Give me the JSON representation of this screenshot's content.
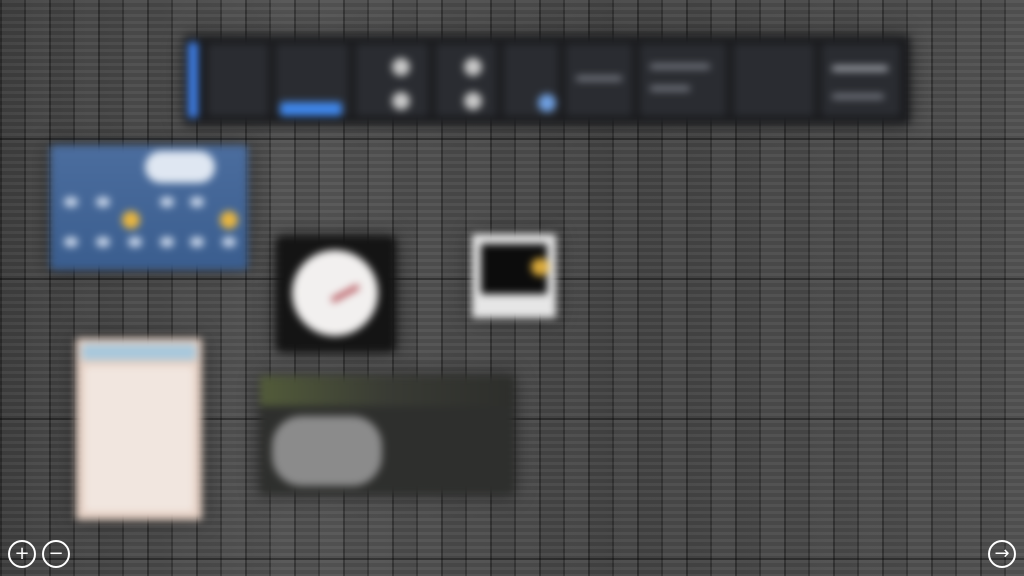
{
  "desktop": {
    "background": "dark-wood",
    "gadgets": [
      {
        "id": "toolbar",
        "name": "system-toolbar-gadget"
      },
      {
        "id": "weather",
        "name": "weather-gadget"
      },
      {
        "id": "clock",
        "name": "clock-gadget"
      },
      {
        "id": "photo",
        "name": "photo-gadget"
      },
      {
        "id": "calendar",
        "name": "calendar-gadget"
      },
      {
        "id": "media",
        "name": "media-gadget"
      }
    ]
  },
  "controls": {
    "zoom_in_icon": "plus-circle-icon",
    "zoom_out_icon": "minus-circle-icon",
    "next_icon": "arrow-right-circle-icon"
  },
  "colors": {
    "accent_blue": "#3f86ea",
    "weather_bg": "#4b6d9e",
    "clock_hand": "#b24a52"
  }
}
